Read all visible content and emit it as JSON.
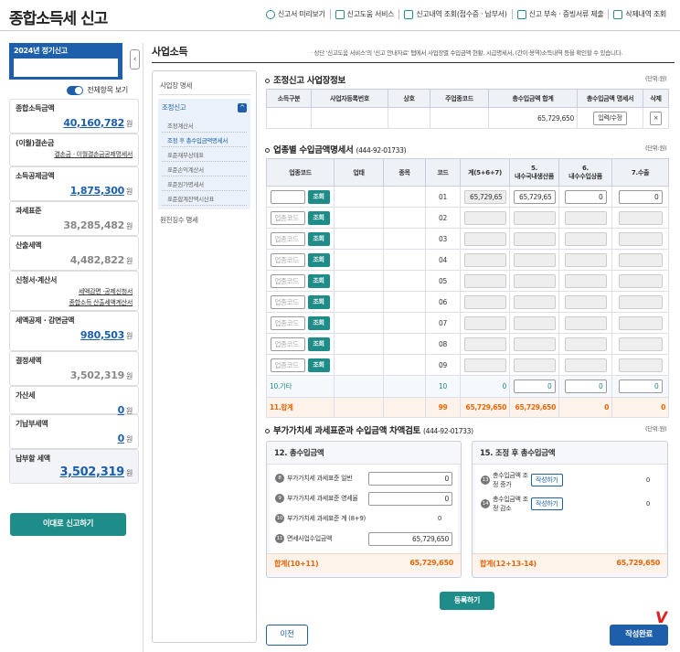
{
  "header": {
    "title": "종합소득세 신고",
    "links": [
      "신고서 미리보기",
      "신고도움 서비스",
      "신고내역 조회(접수증 · 납부서)",
      "신고 부속 · 증빙서류 제출",
      "삭제내역 조회"
    ]
  },
  "left": {
    "year_label": "2024년 정기신고",
    "toggle_label": "전체항목 보기",
    "cards": [
      {
        "title": "종합소득금액",
        "value": "40,160,782",
        "unit": "원",
        "style": "blue"
      },
      {
        "title": "(이월)결손금",
        "sub": "결손금 · 이월결손금공제명세서"
      },
      {
        "title": "소득공제금액",
        "value": "1,875,300",
        "unit": "원",
        "style": "blue"
      },
      {
        "title": "과세표준",
        "value": "38,285,482",
        "unit": "원",
        "style": "gray"
      },
      {
        "title": "산출세액",
        "value": "4,482,822",
        "unit": "원",
        "style": "gray"
      },
      {
        "title": "신청서·계산서",
        "sub": "세액감면 ·공제신청서",
        "sub2": "종합소득 산출세액계산서"
      },
      {
        "title": "세액공제 · 감면금액",
        "value": "980,503",
        "unit": "원",
        "style": "blue"
      },
      {
        "title": "결정세액",
        "value": "3,502,319",
        "unit": "원",
        "style": "gray"
      },
      {
        "title": "가산세",
        "value": "0",
        "unit": "원",
        "style": "blue"
      },
      {
        "title": "기납부세액",
        "value": "0",
        "unit": "원",
        "style": "blue"
      },
      {
        "title": "납부할 세액",
        "value": "3,502,319",
        "unit": "원",
        "style": "big"
      }
    ],
    "submit_button": "이대로 신고하기",
    "collapse_icon": "‹"
  },
  "main": {
    "title": "사업소득",
    "notice": "· 상단 '신고도움 서비스'의 '신고 안내자료' 탭에서 사업장별 수입금액 현황, 시급명세서, (간이·용역)소득내역 등을 확인할 수 있습니다."
  },
  "nav": {
    "top": "사업장 명세",
    "group": "조정신고",
    "group_icon": "^",
    "items": [
      "조정계산서",
      "조정 후 총수입금액명세서",
      "표준재무상태표",
      "표준손익계산서",
      "표준원가명세서",
      "표준합계잔액시산표"
    ],
    "active": 1,
    "bottom": "원천징수 명세"
  },
  "sec1": {
    "title": "조정신고 사업장정보",
    "unit": "(단위:원)",
    "headers": [
      "소득구분",
      "사업자등록번호",
      "상호",
      "주업종코드",
      "총수입금액 합계",
      "총수입금액 명세서",
      "삭제"
    ],
    "row": {
      "total": "65,729,650",
      "button": "입력/수정",
      "delete": "×"
    }
  },
  "sec2": {
    "title": "업종별 수입금액명세서",
    "id": "(444-92-01733)",
    "unit": "(단위:원)",
    "headers": [
      "업종코드",
      "업태",
      "종목",
      "코드",
      "계(5+6+7)",
      "5.\n내수국내생산품",
      "6.\n내수수입상품",
      "7.수출"
    ],
    "lookup": "조회",
    "placeholder": "업종코드",
    "rows": [
      {
        "code": "01",
        "sum": "65,729,65",
        "c5": "65,729,65",
        "c6": "0",
        "c7": "0"
      },
      {
        "code": "02"
      },
      {
        "code": "03"
      },
      {
        "code": "04"
      },
      {
        "code": "05"
      },
      {
        "code": "06"
      },
      {
        "code": "07"
      },
      {
        "code": "08"
      },
      {
        "code": "09"
      }
    ],
    "etc": {
      "label": "10.기타",
      "code": "10",
      "sum": "0",
      "c5": "0",
      "c6": "0",
      "c7": "0"
    },
    "total": {
      "label": "11.합계",
      "code": "99",
      "sum": "65,729,650",
      "c5": "65,729,650",
      "c6": "0",
      "c7": "0"
    }
  },
  "sec3": {
    "title": "부가가치세 과세표준과 수입금액 차액검토",
    "id": "(444-92-01733)",
    "unit": "(단위:원)",
    "box12": {
      "title": "12. 총수입금액",
      "rows": [
        {
          "n": "8",
          "label": "부가가치세 과세표준 일반",
          "value": "0",
          "input": true
        },
        {
          "n": "9",
          "label": "부가가치세 과세표준 영세율",
          "value": "0",
          "input": true
        },
        {
          "n": "10",
          "label": "부가가치세 과세표준 계 (8+9)",
          "value": "0",
          "input": false
        },
        {
          "n": "11",
          "label": "면세사업수입금액",
          "value": "65,729,650",
          "input": true
        }
      ],
      "footer_label": "합계(10+11)",
      "footer_value": "65,729,650"
    },
    "box15": {
      "title": "15. 조정 후 총수입금액",
      "rows": [
        {
          "n": "13",
          "label": "총수입금액 조정 증가",
          "btn": "작성하기",
          "value": "0"
        },
        {
          "n": "14",
          "label": "총수입금액 조정 감소",
          "btn": "작성하기",
          "value": "0"
        }
      ],
      "footer_label": "합계(12+13-14)",
      "footer_value": "65,729,650"
    },
    "register_button": "등록하기"
  },
  "footer": {
    "prev": "이전",
    "done": "작성완료",
    "checkmark": "V"
  },
  "colors": {
    "primary": "#1d5faa",
    "teal": "#1e8c88",
    "total": "#e8660a",
    "check": "#e02020"
  }
}
